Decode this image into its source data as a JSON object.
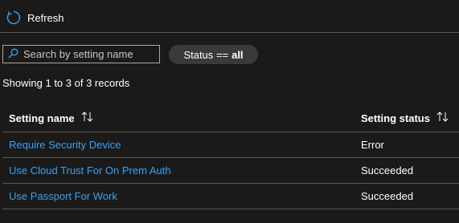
{
  "toolbar": {
    "refresh_label": "Refresh"
  },
  "search": {
    "placeholder": "Search by setting name",
    "value": ""
  },
  "status_filter": {
    "label": "Status ==",
    "value": "all"
  },
  "record_count": "Showing 1 to 3 of 3 records",
  "table": {
    "columns": [
      "Setting name",
      "Setting status"
    ],
    "rows": [
      {
        "name": "Require Security Device",
        "status": "Error"
      },
      {
        "name": "Use Cloud Trust For On Prem Auth",
        "status": "Succeeded"
      },
      {
        "name": "Use Passport For Work",
        "status": "Succeeded"
      }
    ]
  },
  "colors": {
    "background": "#1b1a19",
    "link": "#3aa0f3",
    "accent_icon": "#3aa0f3",
    "pill_background": "#3b3a39",
    "divider": "#5a5a5a"
  },
  "icons": {
    "refresh": "refresh-icon",
    "search": "search-icon",
    "sort": "sort-arrows-icon"
  }
}
